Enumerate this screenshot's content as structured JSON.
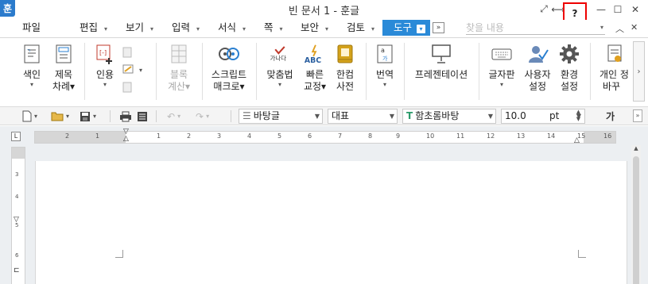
{
  "title": "빈 문서 1 - 훈글",
  "app_logo": "훈",
  "window_controls": {
    "fit": "⤢",
    "split": "⟷",
    "help": "?",
    "minimize": "—",
    "maximize": "☐",
    "close": "✕"
  },
  "menu": {
    "items": [
      "파일",
      "편집",
      "보기",
      "입력",
      "서식",
      "쪽",
      "보안",
      "검토",
      "도구"
    ],
    "active": "도구",
    "more": "»",
    "search_placeholder": "찾을 내용"
  },
  "ribbon": {
    "index": {
      "line1": "색인",
      "dd": "▾"
    },
    "toc": {
      "line1": "제목",
      "line2": "차례▾"
    },
    "quote": {
      "line1": "인용",
      "dd": "▾"
    },
    "block_calc": {
      "line1": "블록",
      "line2": "계산▾"
    },
    "script_macro": {
      "line1": "스크립트",
      "line2": "매크로▾"
    },
    "spell": {
      "line1": "맞춤법",
      "dd": "▾",
      "icon_text": "가나다"
    },
    "quick_correct": {
      "line1": "빠른",
      "line2": "교정▾",
      "icon_text": "ABC"
    },
    "hancom_dict": {
      "line1": "한컴",
      "line2": "사전"
    },
    "translate": {
      "line1": "번역",
      "dd": "▾"
    },
    "presentation": {
      "line1": "프레젠테이션"
    },
    "keyboard": {
      "line1": "글자판",
      "dd": "▾"
    },
    "user_settings": {
      "line1": "사용자",
      "line2": "설정"
    },
    "env_settings": {
      "line1": "환경",
      "line2": "설정"
    },
    "personal": {
      "line1": "개인 정",
      "line2": "바꾸"
    },
    "scroll": "›"
  },
  "toolbar2": {
    "style": "바탕글",
    "lang": "대표",
    "font": "함초롬바탕",
    "size": "10.0",
    "unit": "pt",
    "bold_label": "가"
  },
  "ruler": {
    "h_numbers": [
      "2",
      "1",
      "1",
      "2",
      "3",
      "4",
      "5",
      "6",
      "7",
      "8",
      "9",
      "10",
      "11",
      "12",
      "13",
      "14",
      "15",
      "16"
    ],
    "v_numbers": [
      "3",
      "4",
      "5",
      "6"
    ],
    "corner": "L"
  },
  "colors": {
    "accent": "#2a8ad8",
    "highlight_border": "#e00000"
  }
}
